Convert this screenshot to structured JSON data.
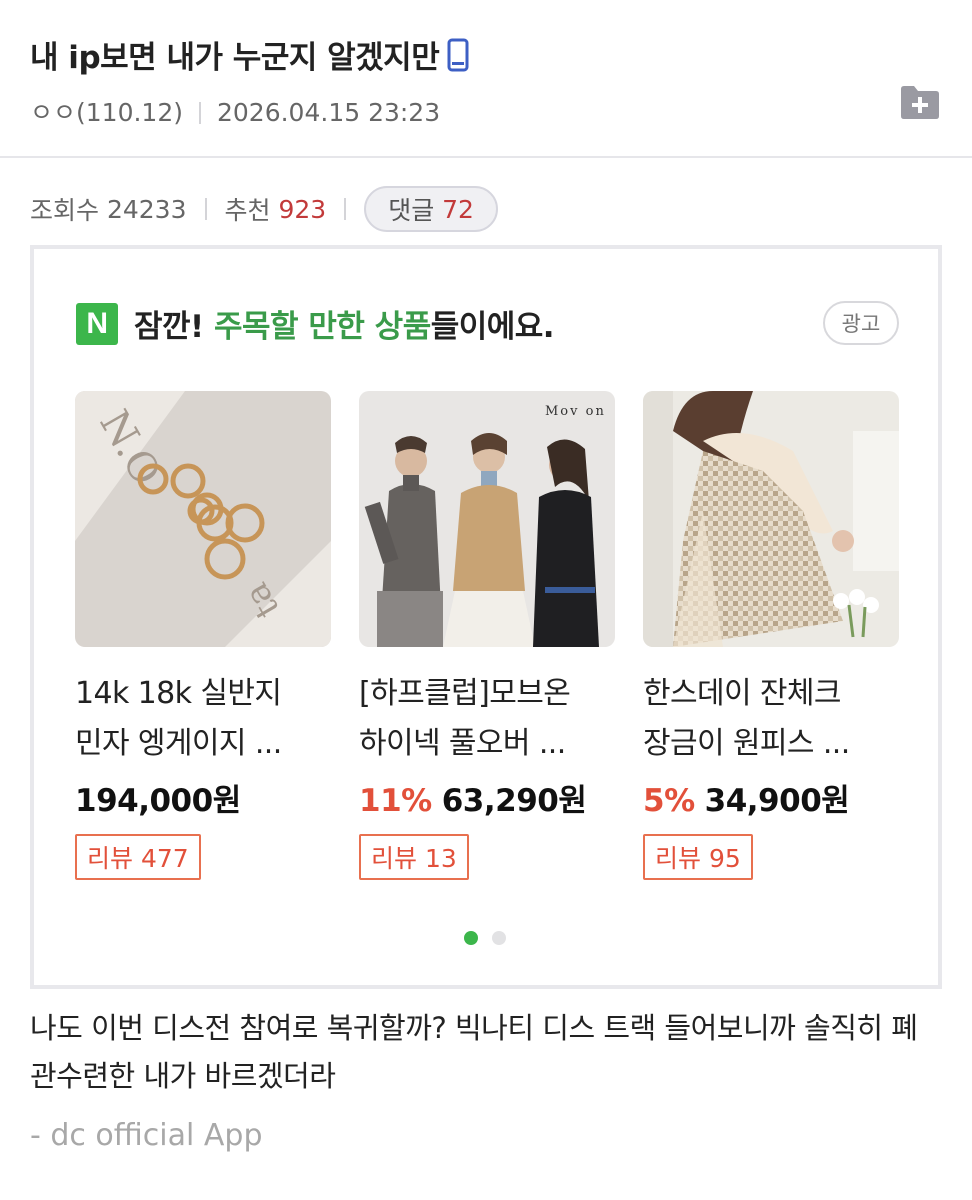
{
  "post": {
    "title": "내 ip보면 내가 누군지 알겠지만",
    "author": "ㅇㅇ(110.12)",
    "date": "2026.04.15 23:23"
  },
  "stats": {
    "views_label": "조회수",
    "views": "24233",
    "recommend_label": "추천",
    "recommend": "923",
    "comments_label": "댓글",
    "comments": "72"
  },
  "ad": {
    "logo": "N",
    "heading_prefix": "잠깐!",
    "heading_highlight": "주목할 만한 상품",
    "heading_suffix": "들이에요.",
    "badge": "광고",
    "products": [
      {
        "name_line1": "14k 18k 실반지",
        "name_line2": "민자 엥게이지 ...",
        "discount": "",
        "price": "194,000원",
        "review": "리뷰 477"
      },
      {
        "name_line1": "[하프클럽]모브온",
        "name_line2": "하이넥 풀오버 ...",
        "discount": "11%",
        "price": "63,290원",
        "review": "리뷰 13",
        "image_brand": "Mov on"
      },
      {
        "name_line1": "한스데이 잔체크",
        "name_line2": "장금이 원피스 ...",
        "discount": "5%",
        "price": "34,900원",
        "review": "리뷰 95"
      }
    ],
    "page_count": 2,
    "active_page": 1
  },
  "body": {
    "text": "나도 이번 디스전 참여로 복귀할까? 빅나티 디스 트랙 들어보니까 솔직히 폐관수련한 내가 바르겠더라",
    "signature": "- dc official App"
  },
  "colors": {
    "accent_green": "#3cb64b",
    "highlight_green": "#3a9b4a",
    "number_red": "#c23a3a",
    "discount_red": "#e2503a"
  }
}
